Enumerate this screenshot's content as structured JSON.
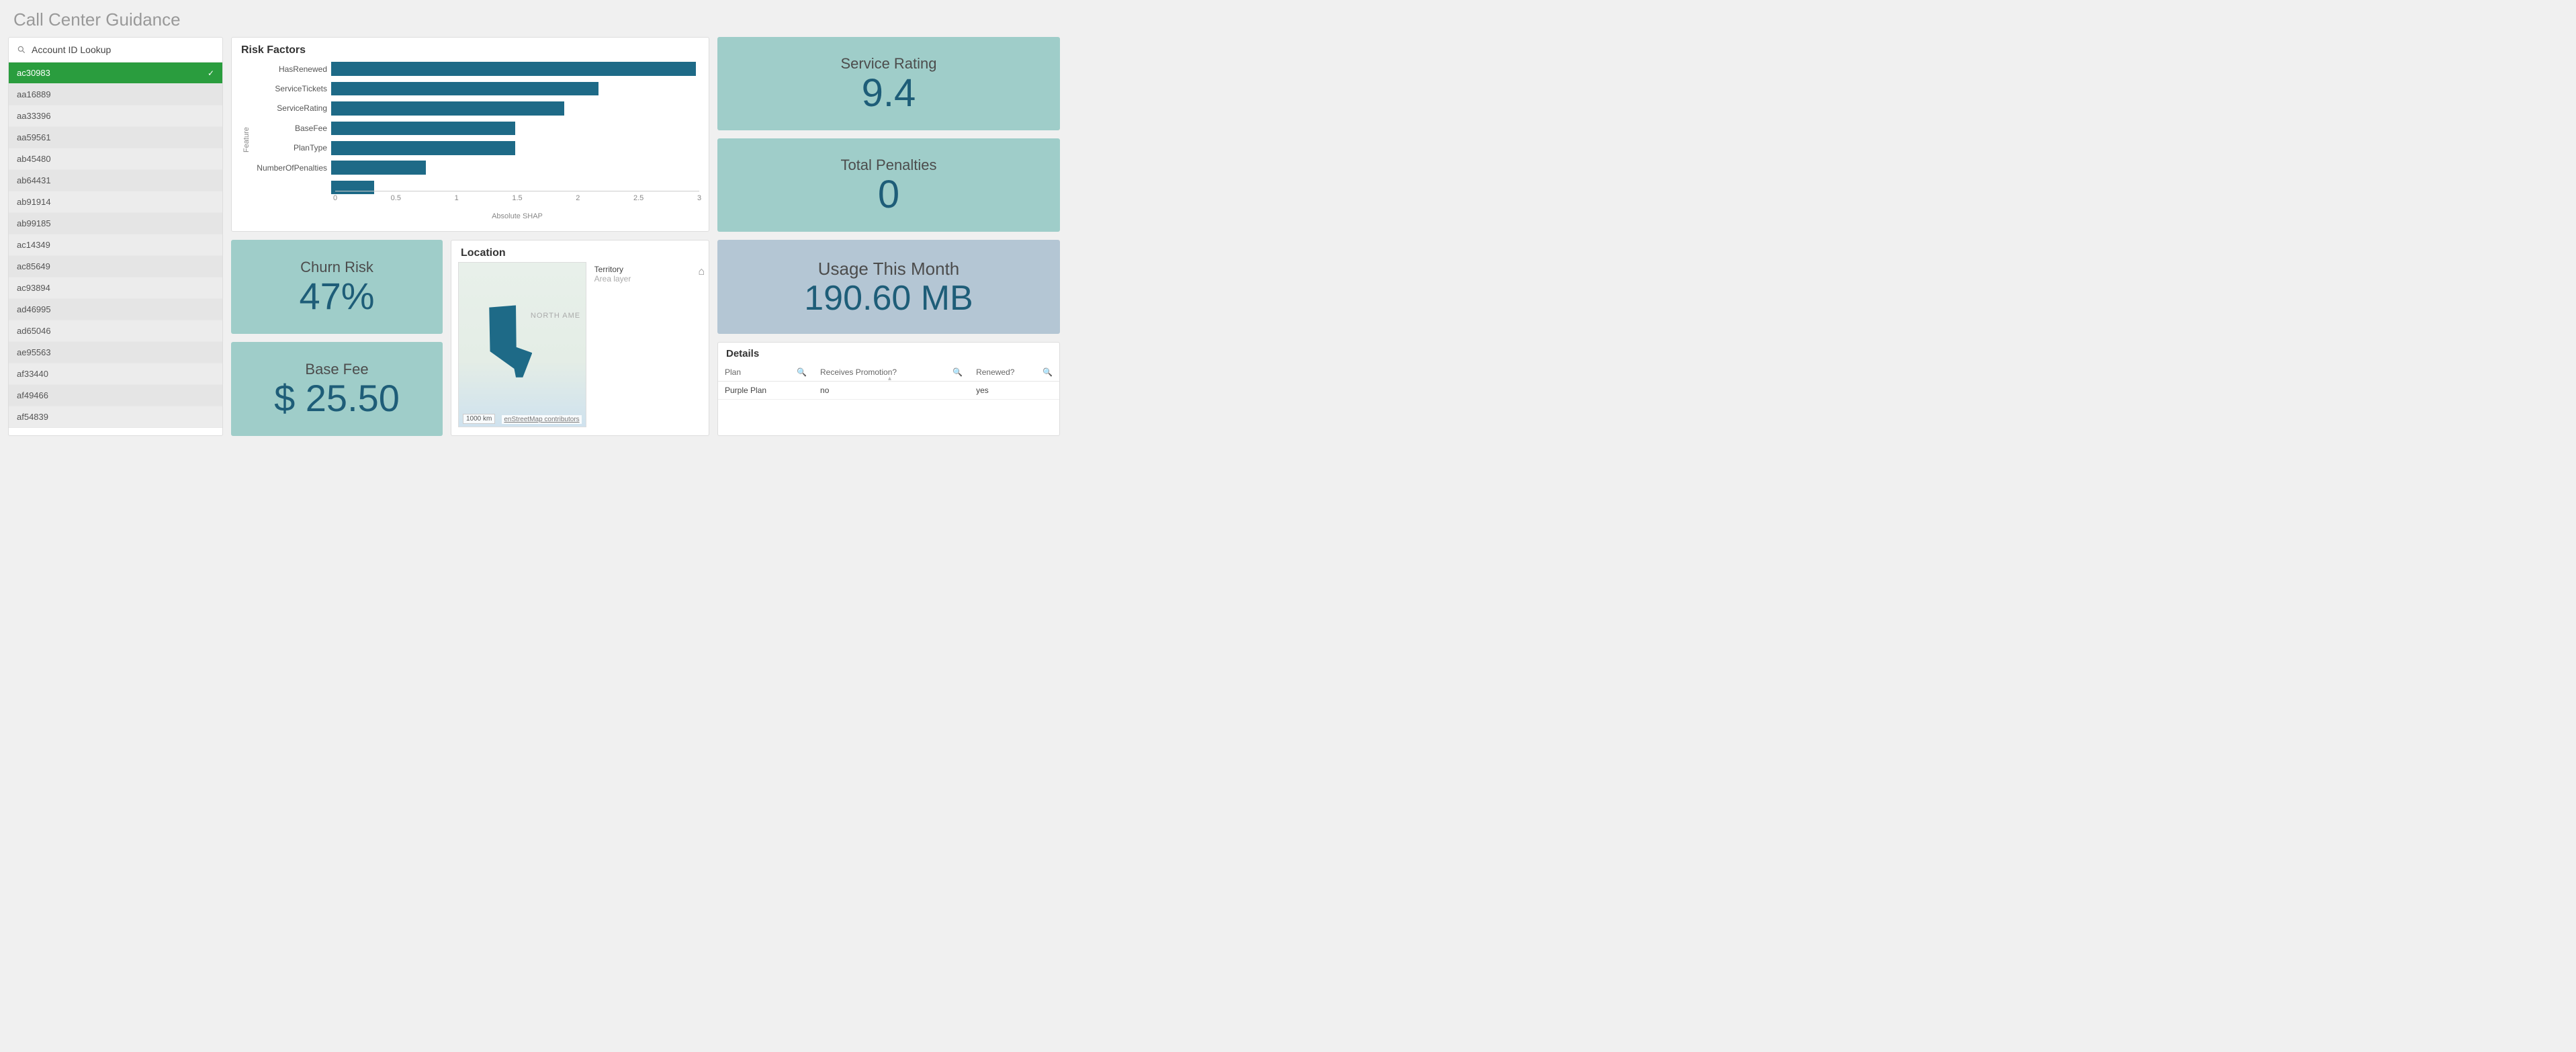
{
  "page_title": "Call Center Guidance",
  "search": {
    "label": "Account ID Lookup"
  },
  "accounts": {
    "selected_index": 0,
    "items": [
      "ac30983",
      "aa16889",
      "aa33396",
      "aa59561",
      "ab45480",
      "ab64431",
      "ab91914",
      "ab99185",
      "ac14349",
      "ac85649",
      "ac93894",
      "ad46995",
      "ad65046",
      "ae95563",
      "af33440",
      "af49466",
      "af54839"
    ]
  },
  "risk_chart": {
    "title": "Risk Factors",
    "y_axis_label": "Feature",
    "x_axis_label": "Absolute SHAP",
    "x_ticks": [
      "0",
      "0.5",
      "1",
      "1.5",
      "2",
      "2.5",
      "3"
    ]
  },
  "chart_data": {
    "type": "bar",
    "orientation": "horizontal",
    "title": "Risk Factors",
    "xlabel": "Absolute SHAP",
    "ylabel": "Feature",
    "x_range": [
      0,
      3
    ],
    "categories": [
      "HasRenewed",
      "ServiceTickets",
      "ServiceRating",
      "BaseFee",
      "PlanType",
      "NumberOfPenalties",
      ""
    ],
    "values": [
      2.97,
      2.18,
      1.9,
      1.5,
      1.5,
      0.77,
      0.35
    ]
  },
  "kpis": {
    "service_rating": {
      "label": "Service Rating",
      "value": "9.4"
    },
    "total_penalties": {
      "label": "Total Penalties",
      "value": "0"
    },
    "churn_risk": {
      "label": "Churn Risk",
      "value": "47%"
    },
    "base_fee": {
      "label": "Base Fee",
      "value": "$ 25.50"
    },
    "usage": {
      "label": "Usage This Month",
      "value": "190.60 MB"
    }
  },
  "location": {
    "title": "Location",
    "legend_title": "Territory",
    "legend_sub": "Area layer",
    "map_text": "NORTH AME",
    "scale": "1000 km",
    "attribution": "enStreetMap contributors"
  },
  "details": {
    "title": "Details",
    "columns": [
      "Plan",
      "Receives Promotion?",
      "Renewed?"
    ],
    "row": {
      "plan": "Purple Plan",
      "promo": "no",
      "renewed": "yes"
    }
  }
}
